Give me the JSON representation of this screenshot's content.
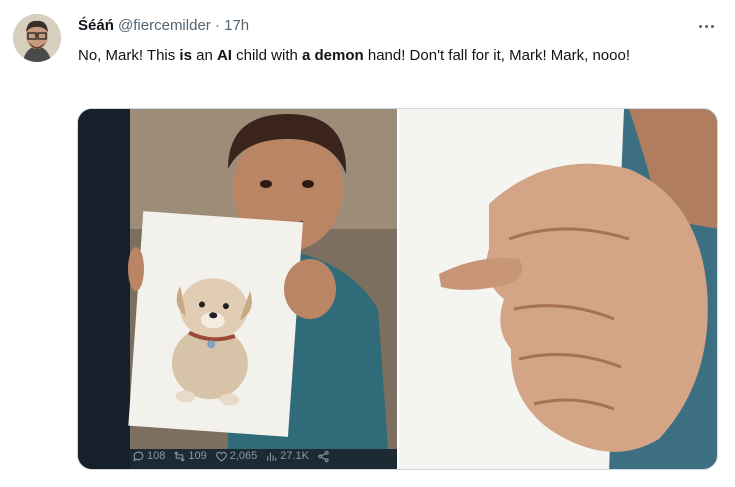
{
  "tweet": {
    "display_name": "Śéáń",
    "handle": "@fiercemilder",
    "separator": "·",
    "time": "17h",
    "text_parts": [
      "No, Mark! This ",
      "is",
      " an ",
      "AI",
      " child with ",
      "a demon",
      " hand! Don't fall for it, Mark! Mark, nooo!"
    ]
  },
  "media": {
    "stats": {
      "replies": "108",
      "retweets": "109",
      "likes": "2,065",
      "views": "27.1K"
    }
  },
  "icons": {
    "more": "more-horizontal-icon",
    "reply": "reply-icon",
    "retweet": "retweet-icon",
    "like": "heart-icon",
    "views": "analytics-icon",
    "share": "share-icon"
  },
  "colors": {
    "text": "#0f1419",
    "secondary": "#536471",
    "border": "#cfd9de"
  }
}
